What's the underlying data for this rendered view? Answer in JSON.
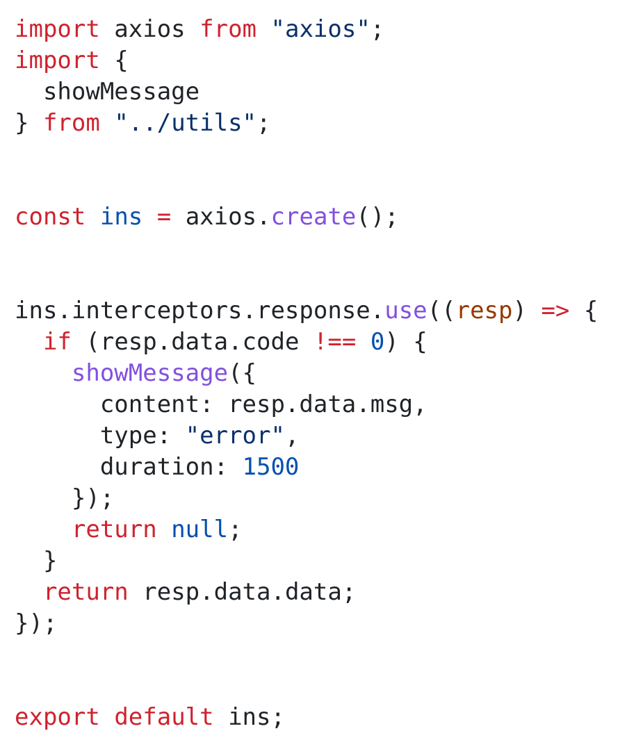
{
  "code": {
    "lines": [
      {
        "tokens": [
          {
            "t": "import",
            "k": "kw"
          },
          {
            "t": " axios ",
            "k": "plain"
          },
          {
            "t": "from",
            "k": "kw"
          },
          {
            "t": " ",
            "k": "plain"
          },
          {
            "t": "\"axios\"",
            "k": "str"
          },
          {
            "t": ";",
            "k": "plain"
          }
        ]
      },
      {
        "tokens": [
          {
            "t": "import",
            "k": "kw"
          },
          {
            "t": " {",
            "k": "plain"
          }
        ]
      },
      {
        "tokens": [
          {
            "t": "  showMessage",
            "k": "plain"
          }
        ]
      },
      {
        "tokens": [
          {
            "t": "} ",
            "k": "plain"
          },
          {
            "t": "from",
            "k": "kw"
          },
          {
            "t": " ",
            "k": "plain"
          },
          {
            "t": "\"../utils\"",
            "k": "str"
          },
          {
            "t": ";",
            "k": "plain"
          }
        ]
      },
      {
        "tokens": []
      },
      {
        "tokens": []
      },
      {
        "tokens": [
          {
            "t": "const",
            "k": "kw"
          },
          {
            "t": " ",
            "k": "plain"
          },
          {
            "t": "ins",
            "k": "var"
          },
          {
            "t": " ",
            "k": "plain"
          },
          {
            "t": "=",
            "k": "op"
          },
          {
            "t": " axios.",
            "k": "plain"
          },
          {
            "t": "create",
            "k": "fn"
          },
          {
            "t": "();",
            "k": "plain"
          }
        ]
      },
      {
        "tokens": []
      },
      {
        "tokens": []
      },
      {
        "tokens": [
          {
            "t": "ins.interceptors.response.",
            "k": "plain"
          },
          {
            "t": "use",
            "k": "fn"
          },
          {
            "t": "((",
            "k": "plain"
          },
          {
            "t": "resp",
            "k": "prm"
          },
          {
            "t": ") ",
            "k": "plain"
          },
          {
            "t": "=>",
            "k": "op"
          },
          {
            "t": " {",
            "k": "plain"
          }
        ]
      },
      {
        "tokens": [
          {
            "t": "  ",
            "k": "plain"
          },
          {
            "t": "if",
            "k": "kw"
          },
          {
            "t": " (resp.data.code ",
            "k": "plain"
          },
          {
            "t": "!==",
            "k": "op"
          },
          {
            "t": " ",
            "k": "plain"
          },
          {
            "t": "0",
            "k": "num"
          },
          {
            "t": ") {",
            "k": "plain"
          }
        ]
      },
      {
        "tokens": [
          {
            "t": "    ",
            "k": "plain"
          },
          {
            "t": "showMessage",
            "k": "fn"
          },
          {
            "t": "({",
            "k": "plain"
          }
        ]
      },
      {
        "tokens": [
          {
            "t": "      content: resp.data.msg,",
            "k": "plain"
          }
        ]
      },
      {
        "tokens": [
          {
            "t": "      type: ",
            "k": "plain"
          },
          {
            "t": "\"error\"",
            "k": "str"
          },
          {
            "t": ",",
            "k": "plain"
          }
        ]
      },
      {
        "tokens": [
          {
            "t": "      duration: ",
            "k": "plain"
          },
          {
            "t": "1500",
            "k": "num"
          }
        ]
      },
      {
        "tokens": [
          {
            "t": "    });",
            "k": "plain"
          }
        ]
      },
      {
        "tokens": [
          {
            "t": "    ",
            "k": "plain"
          },
          {
            "t": "return",
            "k": "kw"
          },
          {
            "t": " ",
            "k": "plain"
          },
          {
            "t": "null",
            "k": "var"
          },
          {
            "t": ";",
            "k": "plain"
          }
        ]
      },
      {
        "tokens": [
          {
            "t": "  }",
            "k": "plain"
          }
        ]
      },
      {
        "tokens": [
          {
            "t": "  ",
            "k": "plain"
          },
          {
            "t": "return",
            "k": "kw"
          },
          {
            "t": " resp.data.data;",
            "k": "plain"
          }
        ]
      },
      {
        "tokens": [
          {
            "t": "});",
            "k": "plain"
          }
        ]
      },
      {
        "tokens": []
      },
      {
        "tokens": []
      },
      {
        "tokens": [
          {
            "t": "export",
            "k": "kw"
          },
          {
            "t": " ",
            "k": "plain"
          },
          {
            "t": "default",
            "k": "kw"
          },
          {
            "t": " ins;",
            "k": "plain"
          }
        ]
      }
    ]
  }
}
